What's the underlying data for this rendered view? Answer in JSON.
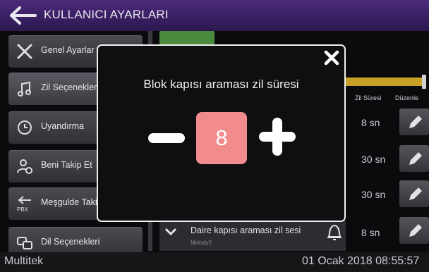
{
  "header": {
    "title": "KULLANICI AYARLARI",
    "back_icon": "back-arrow-icon"
  },
  "sidebar": {
    "items": [
      {
        "label": "Genel Ayarlar",
        "icon": "wrench-screwdriver-icon"
      },
      {
        "label": "Zil Seçenekleri",
        "icon": "music-note-icon"
      },
      {
        "label": "Uyandırma",
        "icon": "clock-icon"
      },
      {
        "label": "Beni Takip Et",
        "icon": "person-follow-icon"
      },
      {
        "label": "Meşgulde Takip",
        "icon": "pbx-forward-icon",
        "icon_text": "PBX"
      },
      {
        "label": "Dil Seçenekleri",
        "icon": "language-icon"
      }
    ]
  },
  "table": {
    "col_duration": "Zil Süresi",
    "col_edit": "Düzenle",
    "durations": [
      "8 sn",
      "30 sn",
      "30 sn",
      "8 sn"
    ],
    "last_row": {
      "title": "Daire kapısı araması zil sesi",
      "subtitle": "Melody2"
    }
  },
  "modal": {
    "label": "Blok kapısı araması zil süresi",
    "value": "8"
  },
  "footer": {
    "brand": "Multitek",
    "datetime": "01 Ocak 2018 08:55:57"
  },
  "colors": {
    "header": "#3a2266",
    "value_box": "#f28b8b",
    "slider": "#c9a126",
    "tab": "#4c8a3e"
  }
}
